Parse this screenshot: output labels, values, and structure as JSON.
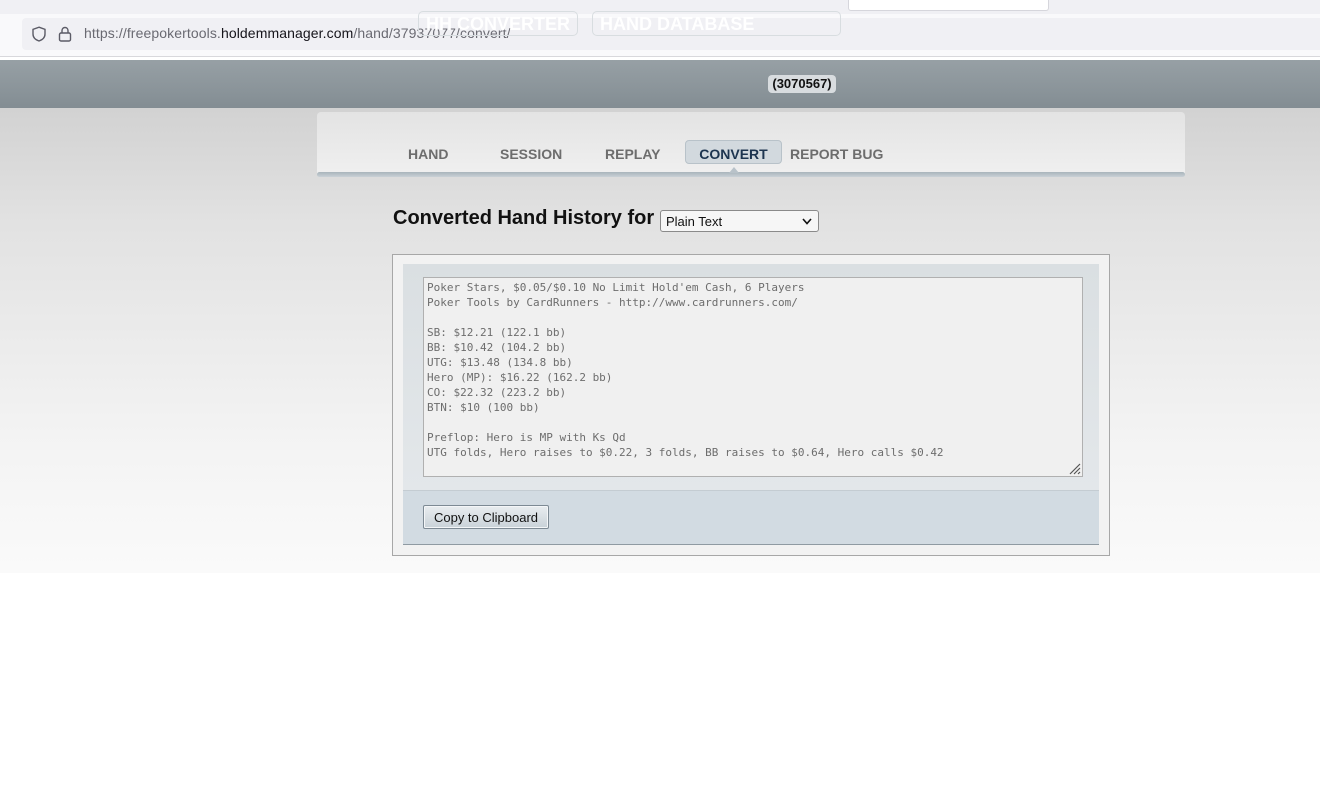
{
  "browser": {
    "url_prefix": "https://freepokertools.",
    "url_host": "holdemmanager.com",
    "url_path": "/hand/37937077/convert/"
  },
  "header": {
    "converter_label": "HH CONVERTER",
    "database_label": "HAND DATABASE",
    "database_count": "(3070567)"
  },
  "nav": {
    "hand": "HAND",
    "session": "SESSION",
    "replay": "REPLAY",
    "convert": "CONVERT",
    "report_bug": "REPORT BUG",
    "active": "CONVERT"
  },
  "converter": {
    "title": "Converted Hand History for",
    "format_selected": "Plain Text",
    "copy_button": "Copy to Clipboard"
  },
  "hand_history": {
    "lines": [
      "Poker Stars, $0.05/$0.10 No Limit Hold'em Cash, 6 Players",
      "Poker Tools by CardRunners - http://www.cardrunners.com/",
      "",
      "SB: $12.21 (122.1 bb)",
      "BB: $10.42 (104.2 bb)",
      "UTG: $13.48 (134.8 bb)",
      "Hero (MP): $16.22 (162.2 bb)",
      "CO: $22.32 (223.2 bb)",
      "BTN: $10 (100 bb)",
      "",
      "Preflop: Hero is MP with Ks Qd",
      "UTG folds, Hero raises to $0.22, 3 folds, BB raises to $0.64, Hero calls $0.42"
    ]
  },
  "icons": {
    "shield": "shield-icon",
    "lock": "lock-icon",
    "select_arrow": "chevron-down-icon",
    "resize": "resize-grip-icon"
  },
  "colors": {
    "header_bg": "#8c969c",
    "active_tab_text": "#1d3550",
    "page_bg": "#e2e2e2"
  }
}
